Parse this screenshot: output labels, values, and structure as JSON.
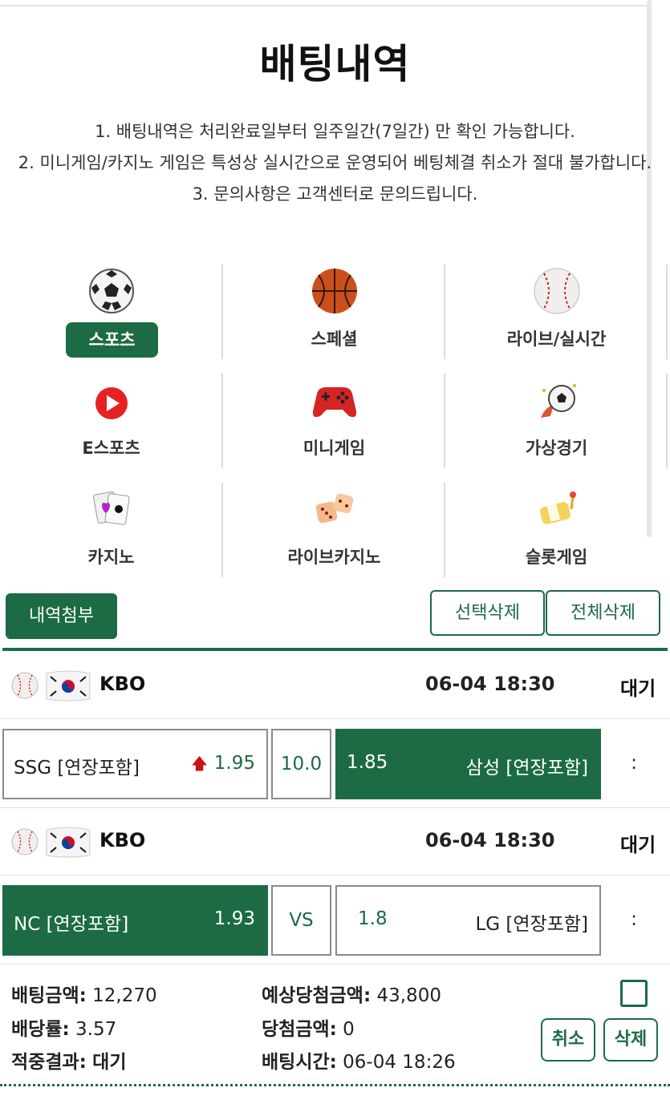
{
  "page_title": "배팅내역",
  "notices": [
    "1. 배팅내역은 처리완료일부터 일주일간(7일간) 만 확인 가능합니다.",
    "2. 미니게임/카지노 게임은 특성상 실시간으로 운영되어 베팅체결 취소가 절대 불가합니다.",
    "3. 문의사항은 고객센터로 문의드립니다."
  ],
  "categories": [
    {
      "label": "스포츠",
      "icon": "soccer-ball-icon",
      "active": true
    },
    {
      "label": "스페셜",
      "icon": "basketball-icon",
      "active": false
    },
    {
      "label": "라이브/실시간",
      "icon": "baseball-icon",
      "active": false
    },
    {
      "label": "E스포츠",
      "icon": "play-icon",
      "active": false
    },
    {
      "label": "미니게임",
      "icon": "gamepad-icon",
      "active": false
    },
    {
      "label": "가상경기",
      "icon": "virtual-soccer-icon",
      "active": false
    },
    {
      "label": "카지노",
      "icon": "cards-icon",
      "active": false
    },
    {
      "label": "라이브카지노",
      "icon": "dice-icon",
      "active": false
    },
    {
      "label": "슬롯게임",
      "icon": "slot-icon",
      "active": false
    }
  ],
  "actions": {
    "attach": "내역첨부",
    "delete_selected": "선택삭제",
    "delete_all": "전체삭제"
  },
  "bets": [
    {
      "league": "KBO",
      "datetime": "06-04 18:30",
      "status": "대기",
      "home": "SSG [연장포함]",
      "home_arrow": "🡅",
      "home_odds": "1.95",
      "middle": "10.0",
      "away_odds": "1.85",
      "away": "삼성 [연장포함]",
      "selected": "away",
      "more": ":"
    },
    {
      "league": "KBO",
      "datetime": "06-04 18:30",
      "status": "대기",
      "home": "NC [연장포함]",
      "home_odds": "1.93",
      "middle": "VS",
      "away_odds": "1.8",
      "away": "LG [연장포함]",
      "selected": "home",
      "more": ":"
    }
  ],
  "summary": {
    "bet_amount_label": "배팅금액:",
    "bet_amount": "12,270",
    "odds_label": "배당률:",
    "odds": "3.57",
    "result_label": "적중결과:",
    "result": "대기",
    "expected_label": "예상당첨금액:",
    "expected": "43,800",
    "win_label": "당첨금액:",
    "win": "0",
    "time_label": "배팅시간:",
    "time": "06-04 18:26",
    "cancel": "취소",
    "delete": "삭제"
  },
  "colors": {
    "accent": "#1c6b45",
    "arrow_up": "#cc1111"
  }
}
